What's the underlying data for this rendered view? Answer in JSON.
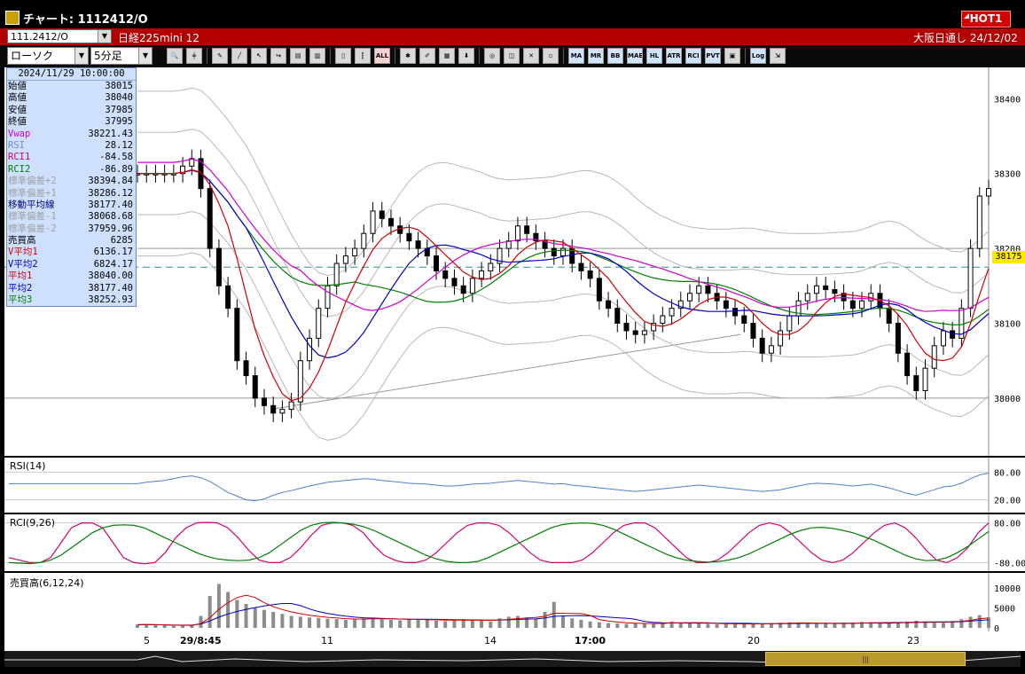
{
  "window": {
    "title": "チャート: 1112412/O",
    "hot_label": "HOT1"
  },
  "infobar": {
    "symbol_code": "111.2412/O",
    "instrument": "日経225mini 12",
    "market_info": "大阪日通し   24/12/02"
  },
  "toolbar": {
    "chart_type": "ローソク",
    "interval": "5分足",
    "buttons": [
      "zoom-icon",
      "crosshair-icon",
      "pen-icon",
      "line-tool-icon",
      "cursor-icon",
      "redo-icon",
      "note-icon",
      "trash-icon",
      "candle-icon",
      "bars-icon",
      "ALL",
      "settings-icon",
      "brush-icon",
      "color-icon",
      "arrow-down-icon",
      "find-icon",
      "chart-alert-icon",
      "cross-icon",
      "blank-icon",
      "MA",
      "MR",
      "BB",
      "MAE",
      "HL",
      "ATR",
      "RCI",
      "PVT",
      "frame-icon",
      "Log",
      "export-icon"
    ]
  },
  "info_panel": {
    "datetime": "2024/11/29  10:00:00",
    "rows": [
      {
        "label": "始値",
        "value": "38015",
        "color": "#000000"
      },
      {
        "label": "高値",
        "value": "38040",
        "color": "#000000"
      },
      {
        "label": "安値",
        "value": "37985",
        "color": "#000000"
      },
      {
        "label": "終値",
        "value": "37995",
        "color": "#000000"
      },
      {
        "label": "Vwap",
        "value": "38221.43",
        "color": "#d000d0"
      },
      {
        "label": "RSI",
        "value": "28.12",
        "color": "#6f8fd0"
      },
      {
        "label": "RCI1",
        "value": "-84.58",
        "color": "#d00070"
      },
      {
        "label": "RCI2",
        "value": "-86.89",
        "color": "#008000"
      },
      {
        "label": "標準偏差+2",
        "value": "38394.84",
        "color": "#a0a0a0"
      },
      {
        "label": "標準偏差+1",
        "value": "38286.12",
        "color": "#a0a0a0"
      },
      {
        "label": "移動平均線",
        "value": "38177.40",
        "color": "#000080"
      },
      {
        "label": "標準偏差-1",
        "value": "38068.68",
        "color": "#a0a0a0"
      },
      {
        "label": "標準偏差-2",
        "value": "37959.96",
        "color": "#a0a0a0"
      },
      {
        "label": "売買高",
        "value": "6285",
        "color": "#000000"
      },
      {
        "label": "V平均1",
        "value": "6136.17",
        "color": "#d00000"
      },
      {
        "label": "V平均2",
        "value": "6824.17",
        "color": "#0000c0"
      },
      {
        "label": "平均1",
        "value": "38040.00",
        "color": "#d00000"
      },
      {
        "label": "平均2",
        "value": "38177.40",
        "color": "#0000c0"
      },
      {
        "label": "平均3",
        "value": "38252.93",
        "color": "#008000"
      }
    ]
  },
  "price_pane": {
    "y_ticks": [
      "38400",
      "38300",
      "38200",
      "38100",
      "38000"
    ],
    "current_price": "38175"
  },
  "rsi_pane": {
    "title": "RSI(14)",
    "ticks": [
      "80.00",
      "20.00"
    ]
  },
  "rci_pane": {
    "title": "RCI(9,26)",
    "ticks": [
      "80.00",
      "-80.00"
    ]
  },
  "volume_pane": {
    "title": "売買高(6,12,24)",
    "ticks": [
      "10000",
      "5000",
      "0"
    ]
  },
  "x_axis": {
    "ticks": [
      {
        "label": "5",
        "bold": false
      },
      {
        "label": "29/8:45",
        "bold": true
      },
      {
        "label": "11",
        "bold": false
      },
      {
        "label": "14",
        "bold": false
      },
      {
        "label": "17:00",
        "bold": true
      },
      {
        "label": "20",
        "bold": false
      },
      {
        "label": "23",
        "bold": false
      }
    ]
  },
  "chart_data": [
    {
      "type": "candlestick",
      "title": "日経225mini 12 5分足",
      "ylim": [
        37930,
        38430
      ],
      "y_ticks": [
        38000,
        38100,
        38200,
        38300,
        38400
      ],
      "horizontal_lines": [
        38000,
        38200,
        38175
      ],
      "points": 95,
      "close_path": [
        38300,
        38300,
        38300,
        38300,
        38300,
        38310,
        38320,
        38280,
        38200,
        38150,
        38120,
        38050,
        38030,
        38000,
        37990,
        37980,
        37985,
        37995,
        38050,
        38080,
        38120,
        38150,
        38180,
        38190,
        38200,
        38220,
        38250,
        38240,
        38230,
        38220,
        38210,
        38200,
        38190,
        38170,
        38160,
        38150,
        38140,
        38160,
        38170,
        38180,
        38200,
        38210,
        38230,
        38220,
        38210,
        38200,
        38190,
        38200,
        38180,
        38170,
        38160,
        38130,
        38120,
        38100,
        38090,
        38085,
        38090,
        38100,
        38110,
        38120,
        38130,
        38140,
        38150,
        38140,
        38130,
        38120,
        38110,
        38100,
        38080,
        38060,
        38070,
        38090,
        38110,
        38130,
        38140,
        38150,
        38145,
        38140,
        38130,
        38120,
        38130,
        38140,
        38120,
        38100,
        38060,
        38030,
        38010,
        38040,
        38070,
        38090,
        38080,
        38120,
        38200,
        38270,
        38280
      ],
      "series": [
        {
          "name": "平均1",
          "color": "#d00000"
        },
        {
          "name": "平均2",
          "color": "#0000c0"
        },
        {
          "name": "平均3",
          "color": "#008000"
        },
        {
          "name": "Vwap",
          "color": "#d000d0"
        }
      ],
      "bands": [
        {
          "name": "標準偏差+2",
          "color": "#a0a0a0"
        },
        {
          "name": "標準偏差+1",
          "color": "#a0a0a0"
        },
        {
          "name": "標準偏差-1",
          "color": "#a0a0a0"
        },
        {
          "name": "標準偏差-2",
          "color": "#a0a0a0"
        }
      ]
    },
    {
      "type": "line",
      "title": "RSI(14)",
      "ylim": [
        0,
        100
      ],
      "y_ticks": [
        20,
        80
      ],
      "series": [
        {
          "name": "RSI",
          "color": "#4f7fd0",
          "values": [
            55,
            58,
            60,
            62,
            66,
            70,
            72,
            68,
            60,
            48,
            36,
            28,
            20,
            18,
            22,
            30,
            36,
            40,
            45,
            50,
            54,
            58,
            60,
            62,
            64,
            66,
            65,
            62,
            60,
            58,
            56,
            55,
            54,
            52,
            50,
            50,
            52,
            54,
            55,
            56,
            58,
            60,
            62,
            60,
            58,
            56,
            54,
            55,
            52,
            50,
            48,
            46,
            44,
            42,
            40,
            38,
            40,
            42,
            44,
            46,
            48,
            50,
            52,
            50,
            48,
            46,
            44,
            42,
            40,
            38,
            40,
            42,
            46,
            50,
            54,
            56,
            55,
            54,
            52,
            50,
            52,
            54,
            50,
            46,
            40,
            34,
            30,
            36,
            42,
            48,
            50,
            56,
            66,
            74,
            78
          ]
        }
      ]
    },
    {
      "type": "line",
      "title": "RCI(9,26)",
      "ylim": [
        -100,
        100
      ],
      "y_ticks": [
        -80,
        80
      ],
      "series": [
        {
          "name": "RCI1",
          "color": "#d00070",
          "values": [
            -60,
            -70,
            -80,
            -80,
            -60,
            0,
            60,
            80,
            80,
            60,
            0,
            -60,
            -80,
            -85,
            -80,
            -40,
            20,
            60,
            80,
            82,
            80,
            60,
            20,
            -30,
            -70,
            -80,
            -80,
            -60,
            -20,
            30,
            70,
            80,
            80,
            70,
            40,
            -10,
            -50,
            -70,
            -80,
            -80,
            -70,
            -40,
            0,
            40,
            70,
            80,
            80,
            70,
            40,
            0,
            -40,
            -70,
            -80,
            -80,
            -80,
            -70,
            -40,
            0,
            40,
            70,
            80,
            80,
            60,
            20,
            -20,
            -60,
            -80,
            -80,
            -70,
            -40,
            0,
            40,
            70,
            80,
            70,
            40,
            0,
            -40,
            -70,
            -80,
            -70,
            -40,
            0,
            40,
            70,
            80,
            60,
            20,
            -30,
            -70,
            -80,
            -60,
            -20,
            40,
            80
          ]
        },
        {
          "name": "RCI2",
          "color": "#008000",
          "values": [
            -80,
            -82,
            -84,
            -80,
            -70,
            -50,
            -20,
            10,
            40,
            60,
            70,
            72,
            70,
            60,
            40,
            20,
            0,
            -20,
            -40,
            -55,
            -65,
            -70,
            -72,
            -70,
            -60,
            -40,
            -10,
            20,
            50,
            70,
            80,
            82,
            80,
            75,
            65,
            50,
            30,
            10,
            -10,
            -30,
            -50,
            -65,
            -75,
            -80,
            -80,
            -75,
            -60,
            -40,
            -20,
            0,
            20,
            40,
            60,
            72,
            78,
            80,
            78,
            70,
            55,
            35,
            15,
            -5,
            -25,
            -45,
            -60,
            -70,
            -75,
            -78,
            -76,
            -70,
            -60,
            -45,
            -25,
            -5,
            15,
            35,
            50,
            60,
            62,
            58,
            50,
            40,
            25,
            10,
            -10,
            -30,
            -50,
            -65,
            -72,
            -70,
            -60,
            -40,
            -15,
            15,
            45
          ]
        }
      ]
    },
    {
      "type": "bar",
      "title": "売買高(6,12,24)",
      "ylim": [
        0,
        12000
      ],
      "y_ticks": [
        0,
        5000,
        10000
      ],
      "values": [
        800,
        900,
        700,
        600,
        500,
        600,
        700,
        3000,
        8000,
        11000,
        9000,
        7000,
        6000,
        5000,
        4500,
        4000,
        3500,
        3000,
        2800,
        2600,
        2500,
        2300,
        2200,
        2000,
        2100,
        2400,
        2600,
        2200,
        2000,
        1900,
        2100,
        2300,
        2000,
        1800,
        1700,
        1900,
        2200,
        2000,
        1800,
        1600,
        2400,
        2800,
        3000,
        2600,
        2200,
        4000,
        6500,
        3000,
        2400,
        2000,
        1600,
        1400,
        1200,
        1100,
        1000,
        1200,
        1100,
        1000,
        1300,
        1600,
        1400,
        1200,
        1100,
        1000,
        900,
        1000,
        1100,
        1000,
        900,
        1100,
        1200,
        1300,
        1400,
        1200,
        1100,
        1000,
        1100,
        1200,
        1000,
        1300,
        1500,
        1400,
        1300,
        1200,
        1400,
        1600,
        1800,
        1500,
        1300,
        1500,
        1700,
        2200,
        2800,
        3200,
        2600
      ],
      "series": [
        {
          "name": "V平均1",
          "color": "#d00000"
        },
        {
          "name": "V平均2",
          "color": "#0000c0"
        }
      ]
    }
  ]
}
